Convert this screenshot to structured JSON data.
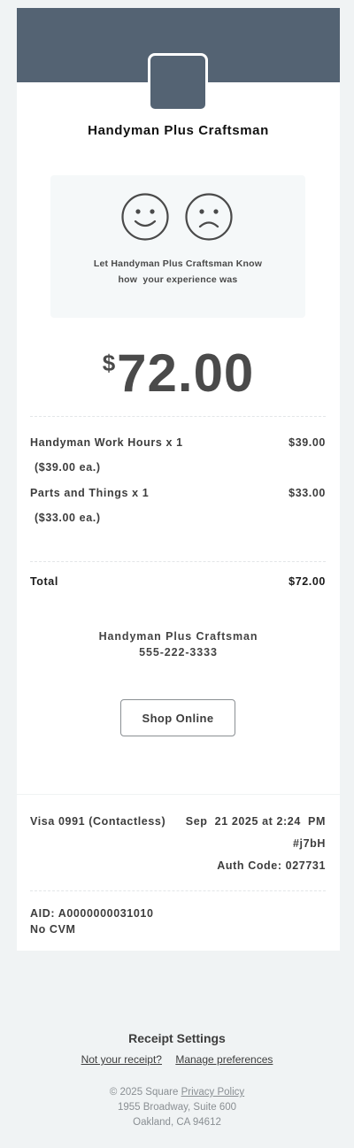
{
  "merchant": {
    "name": "Handyman Plus Craftsman",
    "phone": "555-222-3333"
  },
  "feedback": {
    "line1": "Let Handyman Plus Craftsman Know",
    "line2": "how  your experience was",
    "positive_icon": "smiley-face-icon",
    "negative_icon": "frown-face-icon"
  },
  "amount": {
    "currency": "$",
    "value": "72.00"
  },
  "items": [
    {
      "name": "Handyman Work Hours x 1",
      "price": "$39.00",
      "unit": "($39.00 ea.)"
    },
    {
      "name": "Parts and Things x 1",
      "price": "$33.00",
      "unit": "($33.00 ea.)"
    }
  ],
  "total": {
    "label": "Total",
    "value": "$72.00"
  },
  "shop_button": {
    "label": "Shop Online"
  },
  "payment": {
    "card": "Visa 0991 (Contactless)",
    "date": "Sep  21 2025 at 2:24  PM",
    "ref": "#j7bH",
    "auth": "Auth Code: 027731",
    "aid": "AID: A0000000031010",
    "cvm": "No CVM"
  },
  "footer": {
    "title": "Receipt Settings",
    "not_your_receipt": "Not your receipt?",
    "manage": "Manage preferences",
    "copyright": "© 2025 Square",
    "privacy": "Privacy Policy",
    "address1": "1955 Broadway, Suite 600",
    "address2": "Oakland, CA 94612"
  },
  "colors": {
    "banner": "#546373",
    "background": "#f0f3f4",
    "feedback_bg": "#f5f8f9"
  }
}
